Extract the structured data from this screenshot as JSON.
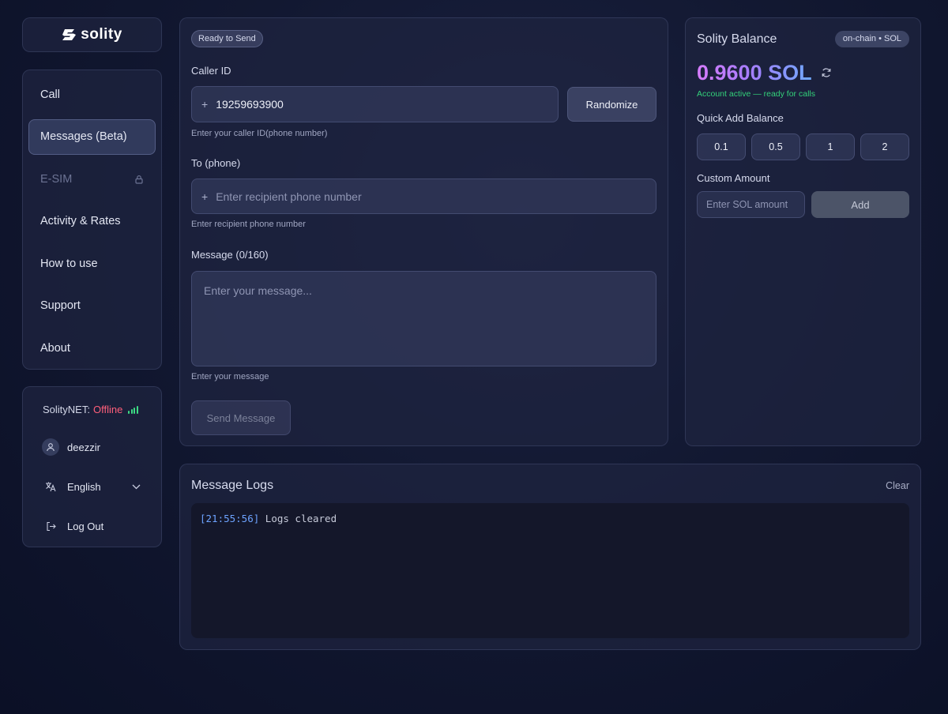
{
  "brand": {
    "name": "solity"
  },
  "nav": {
    "items": [
      {
        "label": "Call"
      },
      {
        "label": "Messages (Beta)"
      },
      {
        "label": "E-SIM"
      },
      {
        "label": "Activity & Rates"
      },
      {
        "label": "How to use"
      },
      {
        "label": "Support"
      },
      {
        "label": "About"
      }
    ]
  },
  "account": {
    "network_label": "SolityNET:",
    "network_status": "Offline",
    "username": "deezzir",
    "language": "English",
    "logout": "Log Out"
  },
  "form": {
    "status": "Ready to Send",
    "caller_label": "Caller ID",
    "caller_prefix": "+",
    "caller_value": "19259693900",
    "randomize": "Randomize",
    "caller_hint": "Enter your caller ID(phone number)",
    "to_label": "To (phone)",
    "to_prefix": "+",
    "to_placeholder": "Enter recipient phone number",
    "to_hint": "Enter recipient phone number",
    "message_label": "Message (0/160)",
    "message_placeholder": "Enter your message...",
    "message_hint": "Enter your message",
    "send": "Send Message"
  },
  "balance": {
    "title": "Solity Balance",
    "chain_badge": "on-chain • SOL",
    "amount": "0.9600 SOL",
    "status": "Account active — ready for calls",
    "quick_label": "Quick Add Balance",
    "quick_amounts": [
      "0.1",
      "0.5",
      "1",
      "2"
    ],
    "custom_label": "Custom Amount",
    "custom_placeholder": "Enter SOL amount",
    "add": "Add"
  },
  "logs": {
    "title": "Message Logs",
    "clear": "Clear",
    "entries": [
      {
        "time": "[21:55:56]",
        "text": "Logs cleared"
      }
    ]
  },
  "colors": {
    "accent_status_offline": "#ff5f7a",
    "status_active": "#33d17a",
    "signal": "#3ddc84",
    "log_time": "#6da3ff"
  }
}
